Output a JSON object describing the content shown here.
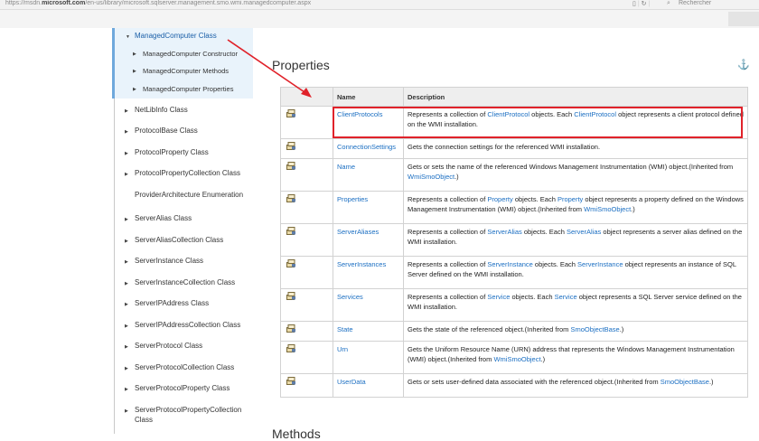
{
  "browser": {
    "url_prefix": "https://msdn.",
    "url_domain": "microsoft.com",
    "url_path": "/en-us/library/microsoft.sqlserver.management.smo.wmi.managedcomputer.aspx",
    "search_placeholder": "Rechercher"
  },
  "sidebar": {
    "active": "ManagedComputer Class",
    "subitems": [
      "ManagedComputer Constructor",
      "ManagedComputer Methods",
      "ManagedComputer Properties"
    ],
    "items": [
      "NetLibInfo Class",
      "ProtocolBase Class",
      "ProtocolProperty Class",
      "ProtocolPropertyCollection Class",
      "ProviderArchitecture Enumeration",
      "ServerAlias Class",
      "ServerAliasCollection Class",
      "ServerInstance Class",
      "ServerInstanceCollection Class",
      "ServerIPAddress Class",
      "ServerIPAddressCollection Class",
      "ServerProtocol Class",
      "ServerProtocolCollection Class",
      "ServerProtocolProperty Class",
      "ServerProtocolPropertyCollection",
      "Class"
    ]
  },
  "main": {
    "heading": "Properties",
    "next_heading": "Methods",
    "table": {
      "headers": [
        "",
        "Name",
        "Description"
      ],
      "rows": [
        {
          "name": "ClientProtocols",
          "parts": [
            {
              "t": "Represents a collection of "
            },
            {
              "t": "ClientProtocol",
              "link": true
            },
            {
              "t": " objects. Each "
            },
            {
              "t": "ClientProtocol",
              "link": true
            },
            {
              "t": " object represents a client protocol defined on the WMI installation."
            }
          ]
        },
        {
          "name": "ConnectionSettings",
          "parts": [
            {
              "t": "Gets the connection settings for the referenced WMI installation."
            }
          ]
        },
        {
          "name": "Name",
          "parts": [
            {
              "t": "Gets or sets the name of the referenced Windows Management Instrumentation (WMI) object.(Inherited from "
            },
            {
              "t": "WmiSmoObject",
              "link": true
            },
            {
              "t": ".)"
            }
          ]
        },
        {
          "name": "Properties",
          "parts": [
            {
              "t": "Represents a collection of "
            },
            {
              "t": "Property",
              "link": true
            },
            {
              "t": " objects. Each "
            },
            {
              "t": "Property",
              "link": true
            },
            {
              "t": " object represents a property defined on the Windows Management Instrumentation (WMI) object.(Inherited from "
            },
            {
              "t": "WmiSmoObject",
              "link": true
            },
            {
              "t": ".)"
            }
          ]
        },
        {
          "name": "ServerAliases",
          "parts": [
            {
              "t": "Represents a collection of "
            },
            {
              "t": "ServerAlias",
              "link": true
            },
            {
              "t": " objects. Each "
            },
            {
              "t": "ServerAlias",
              "link": true
            },
            {
              "t": " object represents a server alias defined on the WMI installation."
            }
          ]
        },
        {
          "name": "ServerInstances",
          "parts": [
            {
              "t": "Represents a collection of "
            },
            {
              "t": "ServerInstance",
              "link": true
            },
            {
              "t": " objects. Each "
            },
            {
              "t": "ServerInstance",
              "link": true
            },
            {
              "t": " object represents an instance of SQL Server defined on the WMI installation."
            }
          ]
        },
        {
          "name": "Services",
          "parts": [
            {
              "t": "Represents a collection of "
            },
            {
              "t": "Service",
              "link": true
            },
            {
              "t": " objects. Each "
            },
            {
              "t": "Service",
              "link": true
            },
            {
              "t": " object represents a SQL Server service defined on the WMI installation."
            }
          ]
        },
        {
          "name": "State",
          "parts": [
            {
              "t": "Gets the state of the referenced object.(Inherited from "
            },
            {
              "t": "SmoObjectBase",
              "link": true
            },
            {
              "t": ".)"
            }
          ]
        },
        {
          "name": "Urn",
          "parts": [
            {
              "t": "Gets the Uniform Resource Name (URN) address that represents the Windows Management Instrumentation (WMI) object.(Inherited from "
            },
            {
              "t": "WmiSmoObject",
              "link": true
            },
            {
              "t": ".)"
            }
          ]
        },
        {
          "name": "UserData",
          "parts": [
            {
              "t": "Gets or sets user-defined data associated with the referenced object.(Inherited from "
            },
            {
              "t": "SmoObjectBase",
              "link": true
            },
            {
              "t": ".)"
            }
          ]
        }
      ]
    }
  },
  "colors": {
    "link": "#1a6ec2",
    "highlight": "#e0222a",
    "active_nav": "#1a5fa8"
  },
  "icons": {
    "property_row": "property-icon",
    "anchor": "anchor-icon"
  }
}
